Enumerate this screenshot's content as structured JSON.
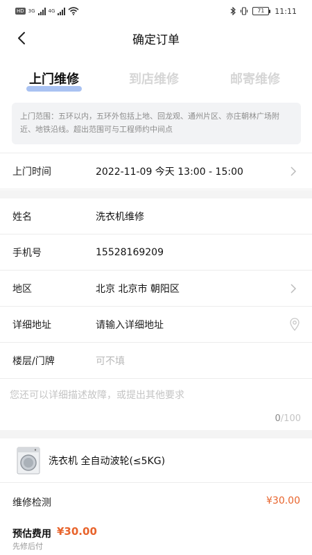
{
  "status_bar": {
    "left_chip": "HD",
    "net_1": "3G",
    "net_2": "4G",
    "battery": "71",
    "time": "11:11"
  },
  "header": {
    "title": "确定订单"
  },
  "tabs": [
    {
      "label": "上门维修",
      "active": true
    },
    {
      "label": "到店维修",
      "active": false
    },
    {
      "label": "邮寄维修",
      "active": false
    }
  ],
  "notice": {
    "text": "上门范围：五环以内，五环外包括上地、回龙观、通州片区、亦庄朝林广场附近、地铁沿线。超出范围可与工程师约中间点"
  },
  "form": {
    "visit_time": {
      "label": "上门时间",
      "value": "2022-11-09 今天 13:00 - 15:00"
    },
    "name": {
      "label": "姓名",
      "value": "洗衣机维修"
    },
    "phone": {
      "label": "手机号",
      "value": "15528169209"
    },
    "region": {
      "label": "地区",
      "value": "北京 北京市 朝阳区"
    },
    "address": {
      "label": "详细地址",
      "placeholder": "请输入详细地址"
    },
    "floor": {
      "label": "楼层/门牌",
      "placeholder": "可不填"
    }
  },
  "description": {
    "placeholder": "您还可以详细描述故障，或提出其他要求",
    "count": "0",
    "max": "/100"
  },
  "product": {
    "name": "洗衣机 全自动波轮(≤5KG)"
  },
  "line_item": {
    "label": "维修检测",
    "price": "¥30.00"
  },
  "footer": {
    "estimate_label": "预估费用",
    "estimate_price": "¥30.00",
    "pay_note": "先修后付"
  },
  "colors": {
    "accent_price": "#e8642c",
    "tab_highlight": "#a9c2f2"
  }
}
